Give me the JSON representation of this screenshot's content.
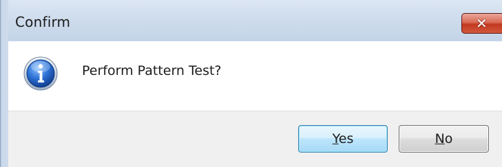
{
  "dialog": {
    "title": "Confirm",
    "close_label": "✕",
    "message": "Perform Pattern Test?",
    "icon": "info-icon",
    "buttons": {
      "yes": {
        "mnemonic": "Y",
        "rest": "es"
      },
      "no": {
        "mnemonic": "N",
        "rest": "o"
      }
    }
  },
  "colors": {
    "titlebar": "#cddbec",
    "close_button": "#c2391f",
    "button_bar": "#f0f0f0",
    "default_button_border": "#3c7fb1",
    "info_icon_blue": "#1f5fc4"
  }
}
